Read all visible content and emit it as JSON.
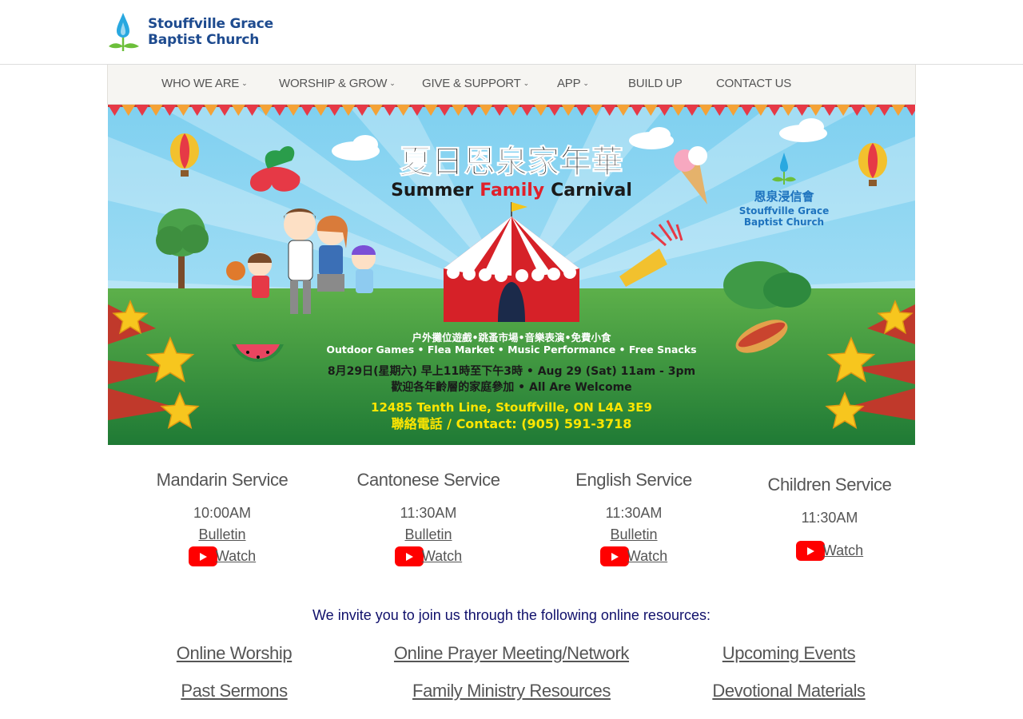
{
  "header": {
    "logo_line1": "Stouffville Grace",
    "logo_line2": "Baptist Church"
  },
  "nav": {
    "items": [
      {
        "label": "WHO WE ARE",
        "has_dropdown": true
      },
      {
        "label": "WORSHIP & GROW",
        "has_dropdown": true
      },
      {
        "label": "GIVE & SUPPORT",
        "has_dropdown": true
      },
      {
        "label": "APP",
        "has_dropdown": true
      },
      {
        "label": "BUILD UP",
        "has_dropdown": false
      },
      {
        "label": "CONTACT US",
        "has_dropdown": false
      }
    ],
    "chevron": "⌄"
  },
  "banner": {
    "title_cn": "夏日恩泉家年華",
    "title_en_1": "Summer",
    "title_en_2": "Family",
    "title_en_3": "Carnival",
    "church_cn": "恩泉浸信會",
    "church_en_1": "Stouffville Grace",
    "church_en_2": "Baptist Church",
    "activities_cn": "户外攤位遊戲•跳蚤市場•音樂表演•免費小食",
    "activities_en": "Outdoor Games • Flea Market • Music Performance • Free Snacks",
    "date_line": "8月29日(星期六) 早上11時至下午3時 • Aug 29 (Sat) 11am - 3pm",
    "welcome_line": "歡迎各年齡層的家庭參加 • All Are Welcome",
    "address": "12485 Tenth Line, Stouffville, ON  L4A 3E9",
    "contact": "聯絡電話 / Contact: (905) 591-3718",
    "colors": {
      "sky": "#8fd6f2",
      "grass": "#3c9a3a",
      "tent_red": "#d62128",
      "title_dark": "#1a1a1a",
      "title_red": "#e0202a",
      "yellow_text": "#ffe600"
    }
  },
  "services": [
    {
      "title": "Mandarin Service",
      "time": "10:00AM",
      "bulletin": "Bulletin",
      "watch": "Watch"
    },
    {
      "title": "Cantonese Service",
      "time": "11:30AM",
      "bulletin": "Bulletin",
      "watch": "Watch"
    },
    {
      "title": "English Service",
      "time": "11:30AM",
      "bulletin": "Bulletin",
      "watch": "Watch"
    },
    {
      "title": "Children Service",
      "time": "11:30AM",
      "watch": "Watch"
    }
  ],
  "invite": "We invite you to join us through the following online resources:",
  "resources": [
    "Online Worship",
    "Online Prayer Meeting/Network",
    "Upcoming Events",
    "Past Sermons",
    "Family Ministry Resources",
    "Devotional Materials"
  ],
  "icons": {
    "logo": "water-drop-sprout-icon",
    "youtube": "youtube-play-icon"
  }
}
